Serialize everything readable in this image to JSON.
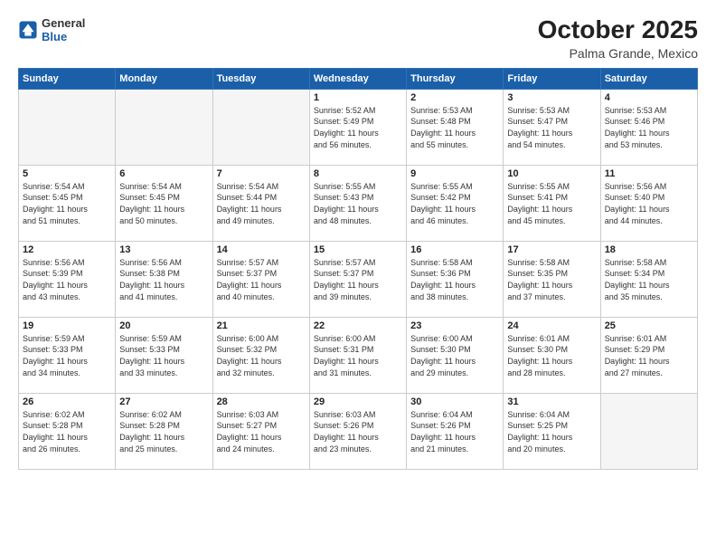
{
  "header": {
    "logo_general": "General",
    "logo_blue": "Blue",
    "month": "October 2025",
    "location": "Palma Grande, Mexico"
  },
  "weekdays": [
    "Sunday",
    "Monday",
    "Tuesday",
    "Wednesday",
    "Thursday",
    "Friday",
    "Saturday"
  ],
  "weeks": [
    [
      {
        "day": "",
        "info": ""
      },
      {
        "day": "",
        "info": ""
      },
      {
        "day": "",
        "info": ""
      },
      {
        "day": "1",
        "info": "Sunrise: 5:52 AM\nSunset: 5:49 PM\nDaylight: 11 hours\nand 56 minutes."
      },
      {
        "day": "2",
        "info": "Sunrise: 5:53 AM\nSunset: 5:48 PM\nDaylight: 11 hours\nand 55 minutes."
      },
      {
        "day": "3",
        "info": "Sunrise: 5:53 AM\nSunset: 5:47 PM\nDaylight: 11 hours\nand 54 minutes."
      },
      {
        "day": "4",
        "info": "Sunrise: 5:53 AM\nSunset: 5:46 PM\nDaylight: 11 hours\nand 53 minutes."
      }
    ],
    [
      {
        "day": "5",
        "info": "Sunrise: 5:54 AM\nSunset: 5:45 PM\nDaylight: 11 hours\nand 51 minutes."
      },
      {
        "day": "6",
        "info": "Sunrise: 5:54 AM\nSunset: 5:45 PM\nDaylight: 11 hours\nand 50 minutes."
      },
      {
        "day": "7",
        "info": "Sunrise: 5:54 AM\nSunset: 5:44 PM\nDaylight: 11 hours\nand 49 minutes."
      },
      {
        "day": "8",
        "info": "Sunrise: 5:55 AM\nSunset: 5:43 PM\nDaylight: 11 hours\nand 48 minutes."
      },
      {
        "day": "9",
        "info": "Sunrise: 5:55 AM\nSunset: 5:42 PM\nDaylight: 11 hours\nand 46 minutes."
      },
      {
        "day": "10",
        "info": "Sunrise: 5:55 AM\nSunset: 5:41 PM\nDaylight: 11 hours\nand 45 minutes."
      },
      {
        "day": "11",
        "info": "Sunrise: 5:56 AM\nSunset: 5:40 PM\nDaylight: 11 hours\nand 44 minutes."
      }
    ],
    [
      {
        "day": "12",
        "info": "Sunrise: 5:56 AM\nSunset: 5:39 PM\nDaylight: 11 hours\nand 43 minutes."
      },
      {
        "day": "13",
        "info": "Sunrise: 5:56 AM\nSunset: 5:38 PM\nDaylight: 11 hours\nand 41 minutes."
      },
      {
        "day": "14",
        "info": "Sunrise: 5:57 AM\nSunset: 5:37 PM\nDaylight: 11 hours\nand 40 minutes."
      },
      {
        "day": "15",
        "info": "Sunrise: 5:57 AM\nSunset: 5:37 PM\nDaylight: 11 hours\nand 39 minutes."
      },
      {
        "day": "16",
        "info": "Sunrise: 5:58 AM\nSunset: 5:36 PM\nDaylight: 11 hours\nand 38 minutes."
      },
      {
        "day": "17",
        "info": "Sunrise: 5:58 AM\nSunset: 5:35 PM\nDaylight: 11 hours\nand 37 minutes."
      },
      {
        "day": "18",
        "info": "Sunrise: 5:58 AM\nSunset: 5:34 PM\nDaylight: 11 hours\nand 35 minutes."
      }
    ],
    [
      {
        "day": "19",
        "info": "Sunrise: 5:59 AM\nSunset: 5:33 PM\nDaylight: 11 hours\nand 34 minutes."
      },
      {
        "day": "20",
        "info": "Sunrise: 5:59 AM\nSunset: 5:33 PM\nDaylight: 11 hours\nand 33 minutes."
      },
      {
        "day": "21",
        "info": "Sunrise: 6:00 AM\nSunset: 5:32 PM\nDaylight: 11 hours\nand 32 minutes."
      },
      {
        "day": "22",
        "info": "Sunrise: 6:00 AM\nSunset: 5:31 PM\nDaylight: 11 hours\nand 31 minutes."
      },
      {
        "day": "23",
        "info": "Sunrise: 6:00 AM\nSunset: 5:30 PM\nDaylight: 11 hours\nand 29 minutes."
      },
      {
        "day": "24",
        "info": "Sunrise: 6:01 AM\nSunset: 5:30 PM\nDaylight: 11 hours\nand 28 minutes."
      },
      {
        "day": "25",
        "info": "Sunrise: 6:01 AM\nSunset: 5:29 PM\nDaylight: 11 hours\nand 27 minutes."
      }
    ],
    [
      {
        "day": "26",
        "info": "Sunrise: 6:02 AM\nSunset: 5:28 PM\nDaylight: 11 hours\nand 26 minutes."
      },
      {
        "day": "27",
        "info": "Sunrise: 6:02 AM\nSunset: 5:28 PM\nDaylight: 11 hours\nand 25 minutes."
      },
      {
        "day": "28",
        "info": "Sunrise: 6:03 AM\nSunset: 5:27 PM\nDaylight: 11 hours\nand 24 minutes."
      },
      {
        "day": "29",
        "info": "Sunrise: 6:03 AM\nSunset: 5:26 PM\nDaylight: 11 hours\nand 23 minutes."
      },
      {
        "day": "30",
        "info": "Sunrise: 6:04 AM\nSunset: 5:26 PM\nDaylight: 11 hours\nand 21 minutes."
      },
      {
        "day": "31",
        "info": "Sunrise: 6:04 AM\nSunset: 5:25 PM\nDaylight: 11 hours\nand 20 minutes."
      },
      {
        "day": "",
        "info": ""
      }
    ]
  ]
}
